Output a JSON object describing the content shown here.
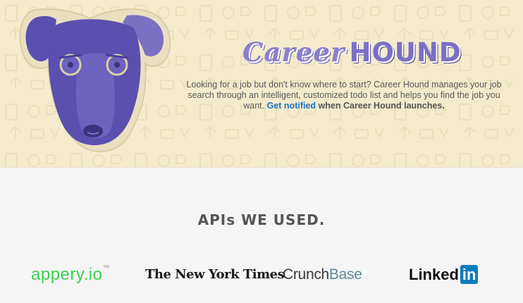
{
  "hero": {
    "brand_script": "Career",
    "brand_bold": "HOUND",
    "description": "Looking for a job but don't know where to start? Career Hound manages your job search through an intelligent, customized todo list and helps you find the job you want.",
    "cta_link": "Get notified",
    "cta_suffix": "when Career Hound launches."
  },
  "apis": {
    "title": "APIs WE USED.",
    "logos": {
      "appery_main": "appery.io",
      "appery_tm": "™",
      "nyt": "The New York Times",
      "crunch_1": "Crunch",
      "crunch_2": "Base",
      "linkedin_text": "Linked",
      "linkedin_box": "in"
    }
  },
  "colors": {
    "hero_bg": "#f3ebcc",
    "dog_purple": "#5b4fb0",
    "link_blue": "#1e74c6",
    "appery_green": "#3ccf4e",
    "linkedin_blue": "#0b7bbd"
  }
}
